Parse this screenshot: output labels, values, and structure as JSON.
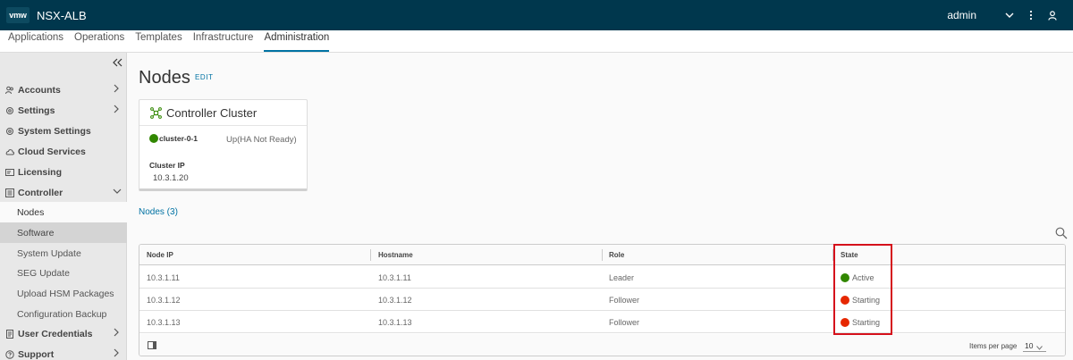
{
  "header": {
    "logo": "vmw",
    "app_title": "NSX-ALB",
    "user": "admin",
    "icons": [
      "chevron-down-icon",
      "more-vertical-icon",
      "user-icon"
    ],
    "background_color": "#00374d"
  },
  "nav_tabs": [
    {
      "label": "Applications",
      "active": false
    },
    {
      "label": "Operations",
      "active": false
    },
    {
      "label": "Templates",
      "active": false
    },
    {
      "label": "Infrastructure",
      "active": false
    },
    {
      "label": "Administration",
      "active": true
    }
  ],
  "sidebar": {
    "collapse_icon": "double-chevron-left-icon",
    "items": [
      {
        "label": "Accounts",
        "icon": "users-icon",
        "chevron": "right"
      },
      {
        "label": "Settings",
        "icon": "gear-icon",
        "chevron": "right"
      },
      {
        "label": "System Settings",
        "icon": "gear-icon"
      },
      {
        "label": "Cloud Services",
        "icon": "cloud-icon"
      },
      {
        "label": "Licensing",
        "icon": "license-icon"
      },
      {
        "label": "Controller",
        "icon": "controller-icon",
        "chevron": "down"
      }
    ],
    "controller_children": [
      {
        "label": "Nodes",
        "state": "active"
      },
      {
        "label": "Software",
        "state": "hover"
      },
      {
        "label": "System Update",
        "state": "normal"
      },
      {
        "label": "SEG Update",
        "state": "normal"
      },
      {
        "label": "Upload HSM Packages",
        "state": "normal"
      },
      {
        "label": "Configuration Backup",
        "state": "normal"
      }
    ],
    "bottom_items": [
      {
        "label": "User Credentials",
        "icon": "credentials-icon",
        "chevron": "right"
      },
      {
        "label": "Support",
        "icon": "help-icon",
        "chevron": "right"
      }
    ]
  },
  "page": {
    "title": "Nodes",
    "edit_label": "EDIT"
  },
  "cluster_card": {
    "title": "Controller Cluster",
    "node_name": "cluster-0-1",
    "node_status_color": "#318700",
    "status_text": "Up(HA Not Ready)",
    "ip_label": "Cluster IP",
    "ip_value": "10.3.1.20"
  },
  "nodes_section": {
    "count_label": "Nodes (3)"
  },
  "table": {
    "columns": [
      "Node IP",
      "Hostname",
      "Role",
      "State"
    ],
    "rows": [
      {
        "node_ip": "10.3.1.11",
        "hostname": "10.3.1.11",
        "role": "Leader",
        "state": "Active",
        "state_color": "#318700"
      },
      {
        "node_ip": "10.3.1.12",
        "hostname": "10.3.1.12",
        "role": "Follower",
        "state": "Starting",
        "state_color": "#e62700"
      },
      {
        "node_ip": "10.3.1.13",
        "hostname": "10.3.1.13",
        "role": "Follower",
        "state": "Starting",
        "state_color": "#e62700"
      }
    ],
    "footer": {
      "items_per_page_label": "Items per page",
      "items_per_page_value": "10"
    }
  },
  "annotation_color": "#d5101b"
}
